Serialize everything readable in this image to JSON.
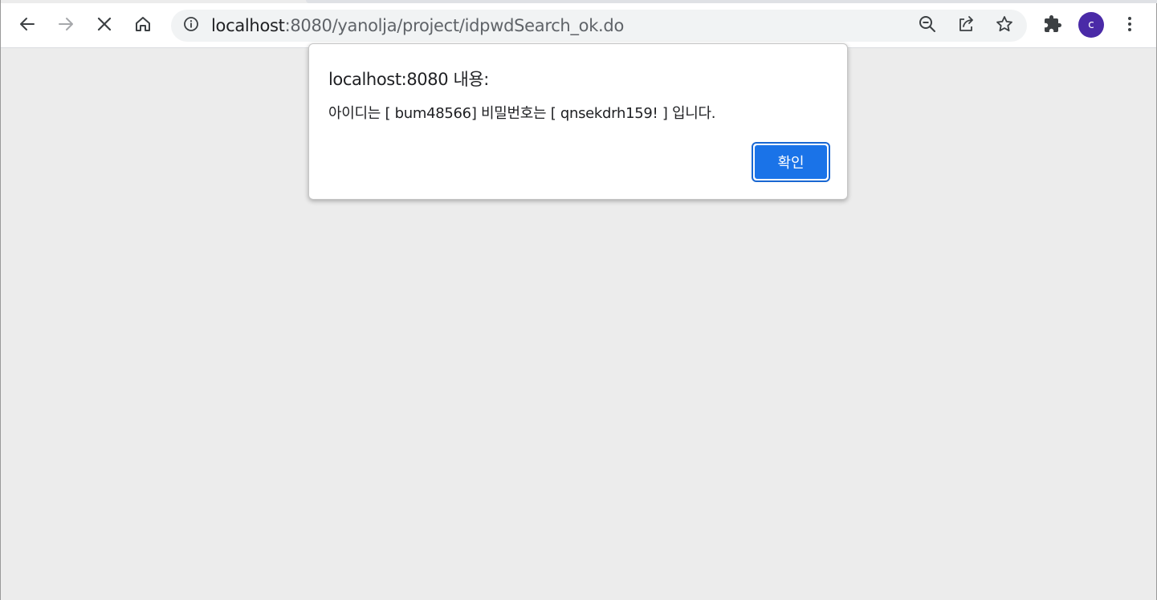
{
  "browser": {
    "url_host": "localhost",
    "url_rest": ":8080/yanolja/project/idpwdSearch_ok.do",
    "profile_initial": "c",
    "icons": {
      "back": "arrow-left-icon",
      "forward": "arrow-right-icon",
      "stop": "close-icon",
      "home": "home-icon",
      "site_info": "info-icon",
      "zoom": "zoom-out-icon",
      "share": "share-icon",
      "bookmark": "star-icon",
      "extensions": "puzzle-icon",
      "menu": "kebab-menu-icon"
    },
    "colors": {
      "avatar": "#4a2aa7",
      "accent": "#1a73e8"
    }
  },
  "dialog": {
    "title": "localhost:8080 내용:",
    "message": "아이디는 [ bum48566] 비밀번호는 [ qnsekdrh159! ] 입니다.",
    "ok_label": "확인"
  }
}
